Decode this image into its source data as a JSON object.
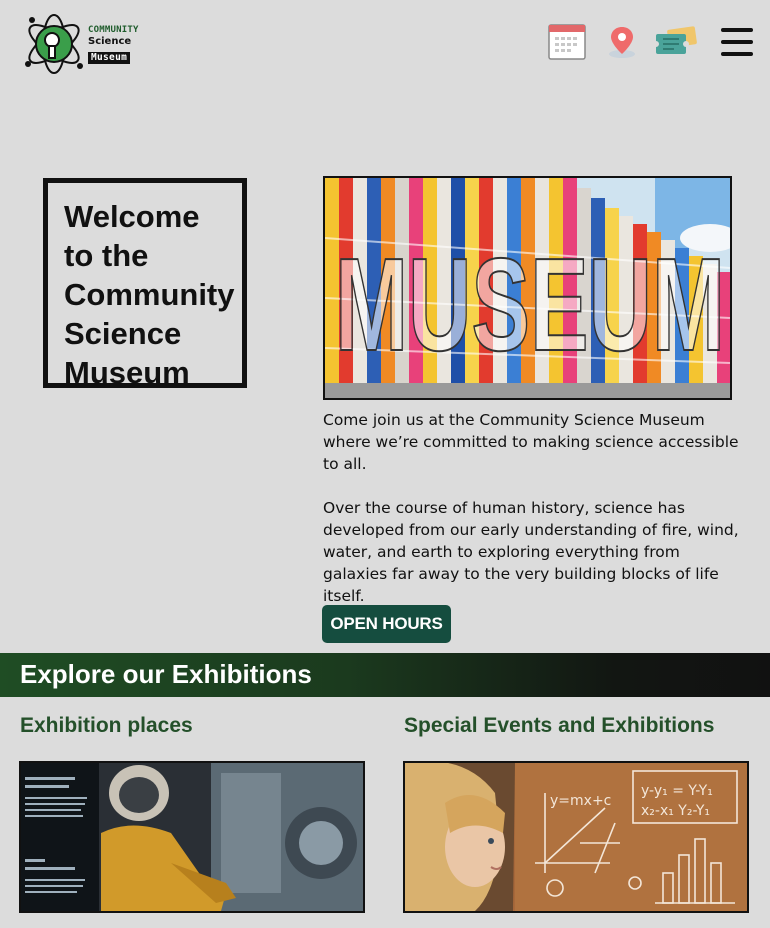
{
  "header": {
    "logo": {
      "line1": "COMMUNITY",
      "line2": "Science",
      "line3": "Museum"
    },
    "icons": [
      "calendar-icon",
      "location-pin-icon",
      "tickets-icon",
      "hamburger-menu-icon"
    ]
  },
  "welcome": {
    "heading": "Welcome to the Community Science Museum"
  },
  "hero": {
    "image_text": "MUSEUM"
  },
  "intro": {
    "p1": "Come join us at the Community Science Museum where we’re committed to making science accessible to all.",
    "p2": "Over the course of human history, science has developed from our early understanding of fire, wind, water, and earth to exploring everything from galaxies far away to the very building blocks of life itself."
  },
  "buttons": {
    "open_hours": "OPEN HOURS"
  },
  "explore": {
    "title": "Explore our Exhibitions",
    "col1_title": "Exhibition places",
    "col2_title": "Special Events and Exhibitions"
  },
  "colors": {
    "brand_green": "#154d3f",
    "title_green": "#24502a",
    "band_dark": "#111111"
  }
}
